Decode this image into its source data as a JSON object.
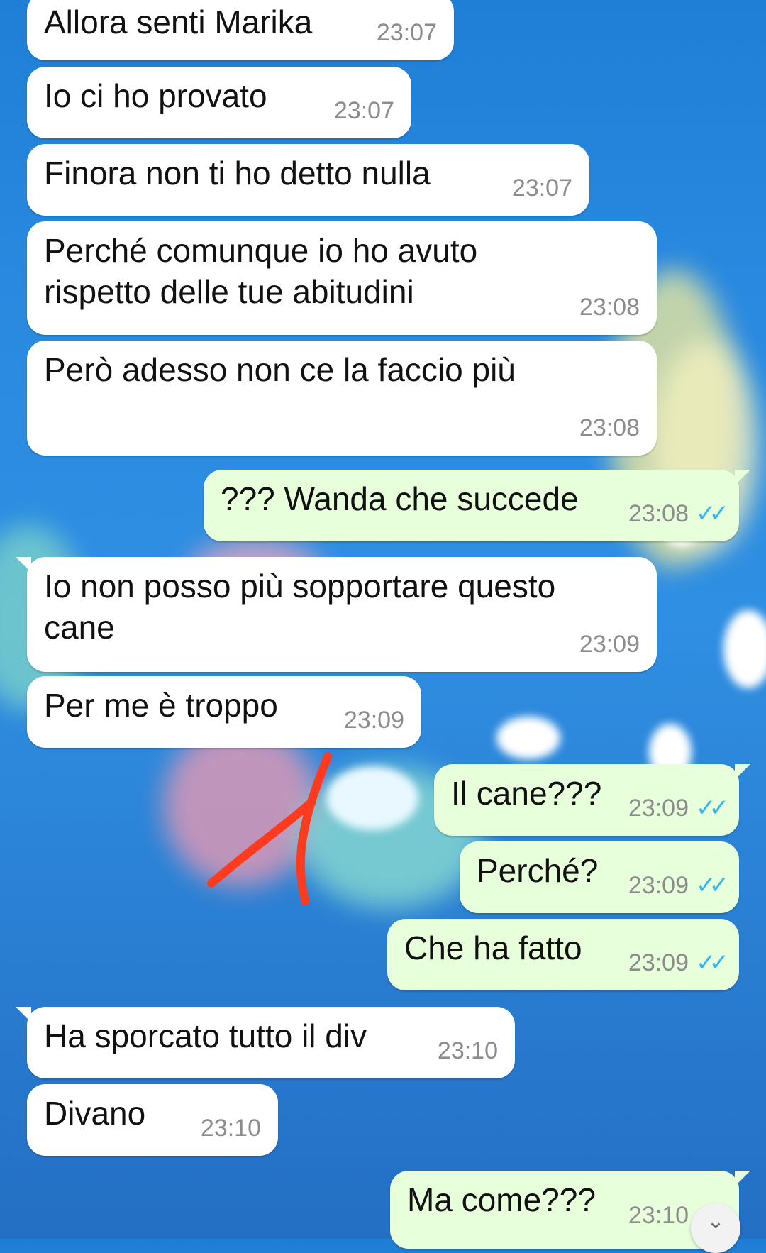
{
  "messages": [
    {
      "side": "in",
      "text": "Allora senti Marika",
      "time": "23:07"
    },
    {
      "side": "in",
      "text": "Io ci ho provato",
      "time": "23:07"
    },
    {
      "side": "in",
      "text": "Finora non ti ho detto nulla",
      "time": "23:07"
    },
    {
      "side": "in",
      "text": "Perché comunque io ho avuto\nrispetto delle tue abitudini",
      "time": "23:08"
    },
    {
      "side": "in",
      "text": "Però adesso non ce la faccio più",
      "time": "23:08"
    },
    {
      "side": "out",
      "text": "??? Wanda che succede",
      "time": "23:08",
      "status": "read"
    },
    {
      "side": "in",
      "text": "Io non posso più sopportare questo\ncane",
      "time": "23:09"
    },
    {
      "side": "in",
      "text": "Per me è troppo",
      "time": "23:09"
    },
    {
      "side": "out",
      "text": "Il cane???",
      "time": "23:09",
      "status": "read"
    },
    {
      "side": "out",
      "text": "Perché?",
      "time": "23:09",
      "status": "read"
    },
    {
      "side": "out",
      "text": "Che ha fatto",
      "time": "23:09",
      "status": "read"
    },
    {
      "side": "in",
      "text": "Ha sporcato tutto il div",
      "time": "23:10"
    },
    {
      "side": "in",
      "text": "Divano",
      "time": "23:10"
    },
    {
      "side": "out",
      "text": "Ma come???",
      "time": "23:10",
      "status": "read"
    }
  ],
  "icons": {
    "read_receipt": "double-check-icon",
    "scroll_down": "chevron-down-icon"
  },
  "colors": {
    "incoming_bubble": "#ffffff",
    "outgoing_bubble": "#e7ffdb",
    "timestamp": "#8c8c8c",
    "read_ticks": "#34b7f1",
    "annotation_stroke": "#ff3b1f",
    "wallpaper": "#2a8ae0"
  },
  "ui": {
    "tick_glyph": "✓✓",
    "chevron_glyph": "⌄"
  }
}
